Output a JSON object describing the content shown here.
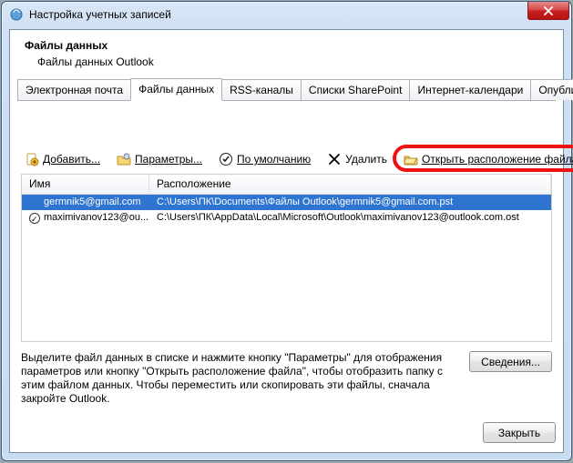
{
  "window": {
    "title": "Настройка учетных записей"
  },
  "header": {
    "title": "Файлы данных",
    "subtitle": "Файлы данных Outlook"
  },
  "tabs": [
    {
      "label": "Электронная почта"
    },
    {
      "label": "Файлы данных"
    },
    {
      "label": "RSS-каналы"
    },
    {
      "label": "Списки SharePoint"
    },
    {
      "label": "Интернет-календари"
    },
    {
      "label": "Опубликован"
    }
  ],
  "active_tab_index": 1,
  "toolbar": {
    "add": "Добавить...",
    "params": "Параметры...",
    "default": "По умолчанию",
    "delete": "Удалить",
    "open_location": "Открыть расположение файла..."
  },
  "columns": {
    "name": "Имя",
    "location": "Расположение"
  },
  "rows": [
    {
      "name": "germnik5@gmail.com",
      "location": "C:\\Users\\ПК\\Documents\\Файлы Outlook\\germnik5@gmail.com.pst",
      "selected": true,
      "default": false
    },
    {
      "name": "maximivanov123@ou...",
      "location": "C:\\Users\\ПК\\AppData\\Local\\Microsoft\\Outlook\\maximivanov123@outlook.com.ost",
      "selected": false,
      "default": true
    }
  ],
  "help_text": "Выделите файл данных в списке и нажмите кнопку \"Параметры\" для отображения параметров или кнопку \"Открыть расположение файла\", чтобы отобразить папку с этим файлом данных. Чтобы переместить или скопировать эти файлы, сначала закройте Outlook.",
  "buttons": {
    "details": "Сведения...",
    "close": "Закрыть"
  },
  "highlight": {
    "target": "toolbar.open_location"
  }
}
